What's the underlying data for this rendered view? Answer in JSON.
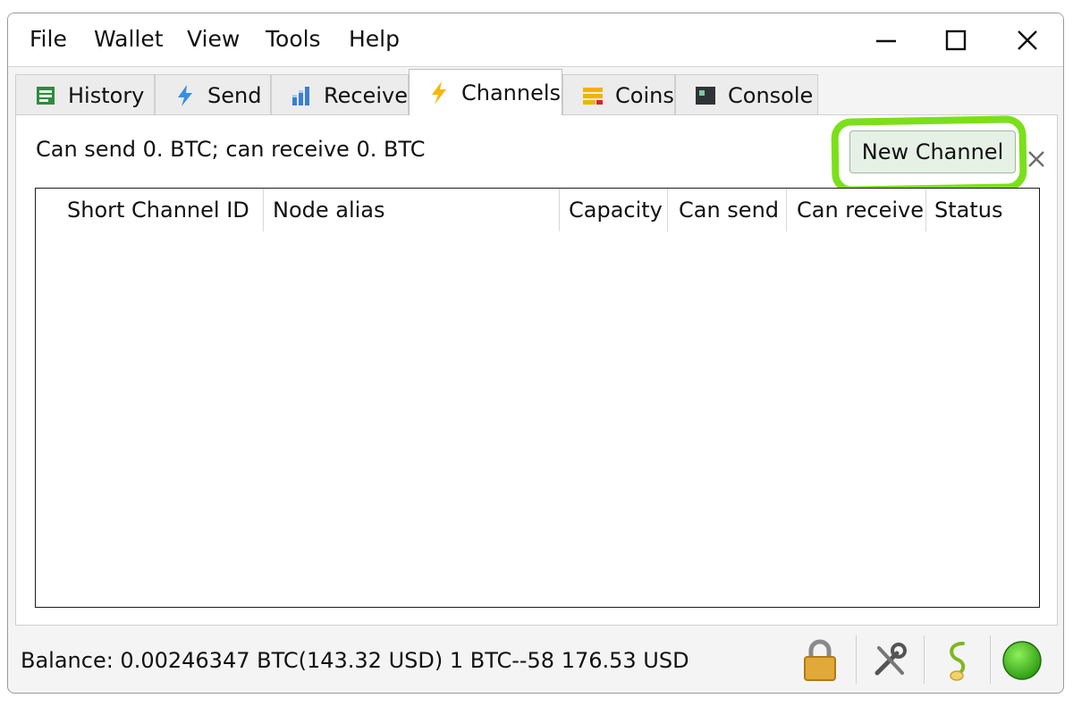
{
  "menu": {
    "items": [
      "File",
      "Wallet",
      "View",
      "Tools",
      "Help"
    ]
  },
  "window_controls": {
    "minimize": "minimize-icon",
    "maximize": "maximize-icon",
    "close": "close-icon"
  },
  "tabs": [
    {
      "label": "History",
      "icon": "history-icon",
      "active": false
    },
    {
      "label": "Send",
      "icon": "lightning-send-icon",
      "active": false
    },
    {
      "label": "Receive",
      "icon": "receive-bars-icon",
      "active": false
    },
    {
      "label": "Channels",
      "icon": "lightning-icon",
      "active": true
    },
    {
      "label": "Coins",
      "icon": "coins-icon",
      "active": false
    },
    {
      "label": "Console",
      "icon": "console-icon",
      "active": false
    }
  ],
  "channels": {
    "summary": "Can send 0. BTC; can receive 0. BTC",
    "new_channel_label": "New Channel",
    "highlight_color": "#7be01a",
    "columns": [
      "Short Channel ID",
      "Node alias",
      "Capacity",
      "Can send",
      "Can receive",
      "Status"
    ],
    "rows": []
  },
  "status": {
    "balance": "Balance: 0.00246347 BTC(143.32 USD)   1 BTC--58 176.53 USD",
    "icons": [
      "lock-icon",
      "tools-icon",
      "seed-icon",
      "network-status-icon"
    ],
    "network_color": "#3fbf1f"
  }
}
